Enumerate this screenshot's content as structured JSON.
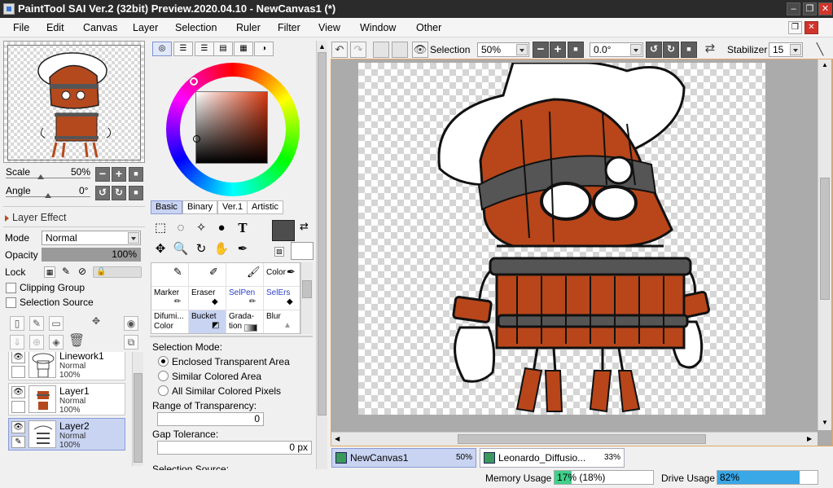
{
  "window": {
    "title": "PaintTool SAI Ver.2 (32bit) Preview.2020.04.10 - NewCanvas1 (*)"
  },
  "menu": [
    "File",
    "Edit",
    "Canvas",
    "Layer",
    "Selection",
    "Ruler",
    "Filter",
    "View",
    "Window",
    "Other"
  ],
  "navigator": {
    "scale_label": "Scale",
    "scale_value": "50%",
    "scale_fraction": 0.5,
    "angle_label": "Angle",
    "angle_value": "0°"
  },
  "layer_effect": {
    "header": "Layer Effect",
    "mode_label": "Mode",
    "mode_value": "Normal",
    "opacity_label": "Opacity",
    "opacity_value": "100%",
    "opacity_fraction": 1.0,
    "lock_label": "Lock",
    "clipping_group": "Clipping Group",
    "selection_source": "Selection Source"
  },
  "layers": [
    {
      "name": "Linework1",
      "mode": "Normal",
      "opacity": "100%",
      "selected": false
    },
    {
      "name": "Layer1",
      "mode": "Normal",
      "opacity": "100%",
      "selected": false
    },
    {
      "name": "Layer2",
      "mode": "Normal",
      "opacity": "100%",
      "selected": true
    }
  ],
  "color": {
    "subtabs": [
      "Basic",
      "Binary",
      "Ver.1",
      "Artistic"
    ],
    "active_subtab": "Basic",
    "primary": "#4d4d4d",
    "secondary": "#ffffff",
    "hue": "#d83a12"
  },
  "brushes": {
    "rows": [
      [
        "",
        "",
        "",
        "Color"
      ],
      [
        "Marker",
        "Eraser",
        "SelPen",
        "SelErs"
      ],
      [
        "Difumi... Color",
        "Bucket",
        "Grada- tion",
        "Blur"
      ]
    ],
    "active": "Bucket"
  },
  "tool_options": {
    "selection_mode_label": "Selection Mode:",
    "modes": [
      "Enclosed Transparent Area",
      "Similar Colored Area",
      "All Similar Colored Pixels"
    ],
    "selected_mode": 0,
    "range_label": "Range of Transparency:",
    "range_value": "0",
    "gap_label": "Gap Tolerance:",
    "gap_value": "0 px",
    "selection_source_label": "Selection Source:"
  },
  "toolbar": {
    "selection_label": "Selection",
    "zoom_value": "50%",
    "angle_value": "0.0°",
    "stabilizer_label": "Stabilizer",
    "stabilizer_value": "15"
  },
  "canvas_tabs": [
    {
      "name": "NewCanvas1",
      "zoom": "50%",
      "active": true
    },
    {
      "name": "Leonardo_Diffusio...",
      "zoom": "33%",
      "active": false
    }
  ],
  "status": {
    "memory_label": "Memory Usage",
    "memory_value": "17% (18%)",
    "memory_fraction": 0.17,
    "drive_label": "Drive Usage",
    "drive_value": "82%",
    "drive_fraction": 0.82,
    "memory_color": "#3fd08a",
    "drive_color": "#3aa7e6"
  }
}
